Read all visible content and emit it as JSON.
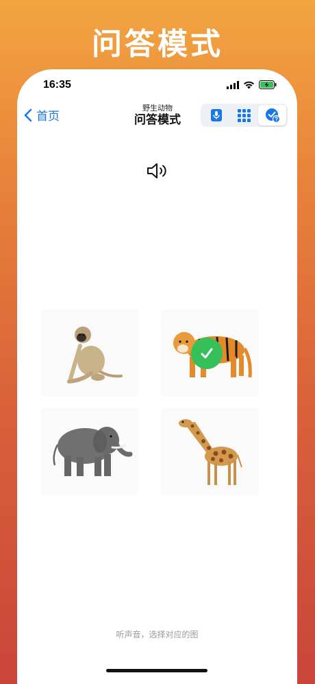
{
  "hero": {
    "title": "问答模式"
  },
  "status_bar": {
    "time": "16:35"
  },
  "nav": {
    "back_label": "首页",
    "subtitle": "野生动物",
    "title": "问答模式",
    "modes": [
      {
        "icon": "microphone-icon",
        "active": false
      },
      {
        "icon": "grid-icon",
        "active": false
      },
      {
        "icon": "quiz-check-icon",
        "active": true
      }
    ]
  },
  "quiz": {
    "options": [
      {
        "icon": "monkey-image",
        "selected": false
      },
      {
        "icon": "tiger-image",
        "selected": true,
        "correct": true
      },
      {
        "icon": "elephant-image",
        "selected": false
      },
      {
        "icon": "giraffe-image",
        "selected": false
      }
    ],
    "hint": "听声音，选择对应的图"
  },
  "colors": {
    "accent": "#1677e6",
    "correct": "#35c05a",
    "background_top": "#f2a541",
    "background_bottom": "#c9453a"
  }
}
